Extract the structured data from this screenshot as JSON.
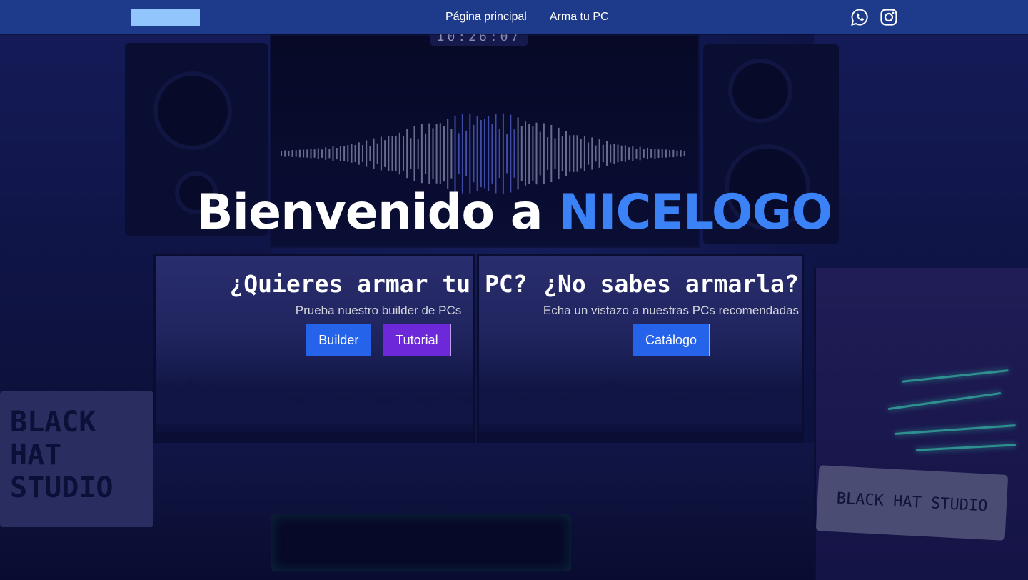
{
  "navbar": {
    "links": [
      "Página principal",
      "Arma tu PC"
    ],
    "social": [
      "whatsapp-icon",
      "instagram-icon"
    ]
  },
  "hero": {
    "title_prefix": "Bienvenido a ",
    "title_brand": "NICELOGO",
    "left": {
      "heading": "¿Quieres armar tu PC?",
      "subtitle": "Prueba nuestro builder de PCs",
      "buttons": [
        "Builder",
        "Tutorial"
      ]
    },
    "right": {
      "heading": "¿No sabes armarla?",
      "subtitle": "Echa un vistazo a nuestras PCs recomendadas",
      "buttons": [
        "Catálogo"
      ]
    }
  },
  "background": {
    "clock_text": "10:26:07",
    "lightbox_text": "BLACK HAT STUDIO",
    "case_label": "BLACK HAT STUDIO"
  },
  "colors": {
    "navbar": "#1e3a8a",
    "logo_placeholder": "#93c5fd",
    "brand_accent": "#3b82f6",
    "button_blue": "#2563eb",
    "button_purple": "#6d28d9"
  }
}
